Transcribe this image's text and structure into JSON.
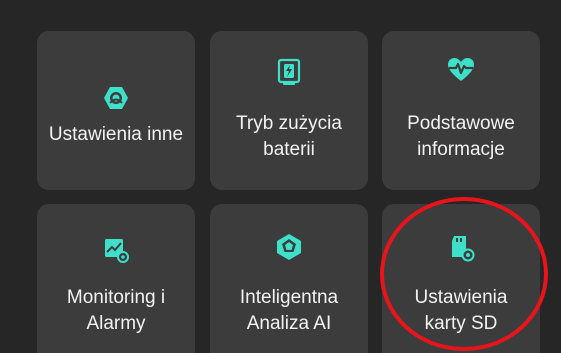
{
  "accent_color": "#3ee0c9",
  "highlight_color": "#e8141b",
  "tiles": [
    {
      "label": "Ustawienia inne",
      "icon": "hexagon-settings-icon"
    },
    {
      "label": "Tryb zużycia\nbaterii",
      "icon": "battery-mode-icon"
    },
    {
      "label": "Podstawowe\ninformacje",
      "icon": "heart-pulse-icon"
    },
    {
      "label": "Monitoring i\nAlarmy",
      "icon": "monitoring-alarm-icon"
    },
    {
      "label": "Inteligentna\nAnaliza AI",
      "icon": "ai-analysis-icon"
    },
    {
      "label": "Ustawienia\nkarty SD",
      "icon": "sd-card-settings-icon"
    }
  ]
}
